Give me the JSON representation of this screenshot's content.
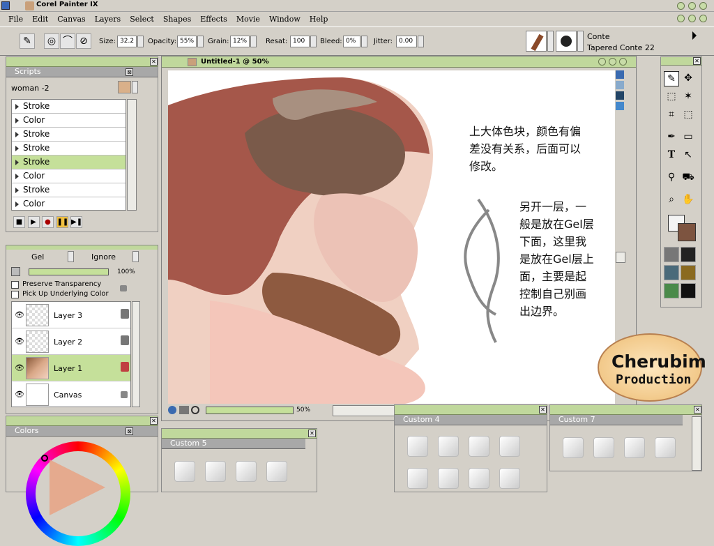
{
  "app": {
    "title": "Corel Painter IX"
  },
  "menu": [
    "File",
    "Edit",
    "Canvas",
    "Layers",
    "Select",
    "Shapes",
    "Effects",
    "Movie",
    "Window",
    "Help"
  ],
  "props": {
    "size_label": "Size:",
    "size_val": "32.2",
    "opacity_label": "Opacity:",
    "opacity_val": "55%",
    "grain_label": "Grain:",
    "grain_val": "12%",
    "resat_label": "Resat:",
    "resat_val": "100",
    "bleed_label": "Bleed:",
    "bleed_val": "0%",
    "jitter_label": "Jitter:",
    "jitter_val": "0.00",
    "brush_category": "Conte",
    "brush_variant": "Tapered Conte 22"
  },
  "scripts": {
    "title": "Scripts",
    "current": "woman -2",
    "items": [
      "Stroke",
      "Color",
      "Stroke",
      "Stroke",
      "Stroke",
      "Color",
      "Stroke",
      "Color"
    ],
    "selected_index": 4
  },
  "layers": {
    "composite": "Gel",
    "depth": "Ignore",
    "opacity": "100%",
    "preserve_transparency": "Preserve Transparency",
    "pick_up": "Pick Up Underlying Color",
    "items": [
      "Layer 3",
      "Layer 2",
      "Layer 1",
      "Canvas"
    ],
    "selected_index": 2
  },
  "colors": {
    "title": "Colors"
  },
  "document": {
    "title": "Untitled-1 @ 50%",
    "zoom": "50%",
    "note1": [
      "上大体色块，颜色有偏",
      "差没有关系，后面可以",
      "修改。"
    ],
    "note2": [
      "另开一层，一",
      "般是放在Gel层",
      "下面，这里我",
      "是放在Gel层上",
      "面，主要是起",
      "控制自己别画",
      "出边界。"
    ]
  },
  "logo": {
    "line1": "Cherubim",
    "line2": "Production"
  },
  "custom_palettes": [
    {
      "title": "Custom 4"
    },
    {
      "title": "Custom 5"
    },
    {
      "title": "Custom 7"
    }
  ],
  "colors_main": {
    "primary": "#f4f4f4",
    "secondary": "#7d5440",
    "accent": "#c5e09a"
  }
}
